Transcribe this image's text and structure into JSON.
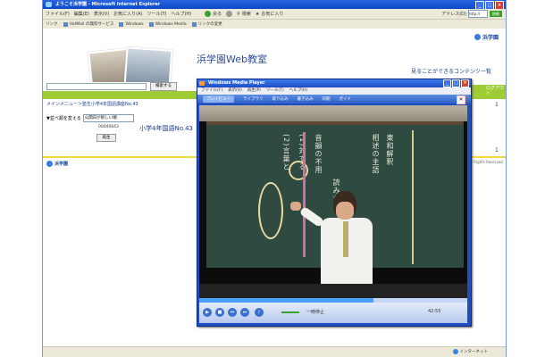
{
  "browser": {
    "title": "ようこそ浜学園 - Microsoft Internet Explorer",
    "menu": [
      "ファイル(F)",
      "編集(E)",
      "表示(V)",
      "お気に入り(A)",
      "ツール(T)",
      "ヘルプ(H)"
    ],
    "back_label": "戻る",
    "search_label": "検索",
    "favorites_label": "お気に入り",
    "address_label": "アドレス(D)",
    "address_value": "http://",
    "go_label": "移動",
    "links": [
      "リンク",
      "HotMail の無料サービス",
      "Windows",
      "Windows Media",
      "リンクの変更"
    ],
    "status_zone": "インターネット"
  },
  "page": {
    "logo": "浜学園",
    "site_title": "浜学園Web教室",
    "site_link": "見ることができるコンテンツ一覧",
    "search_button": "検索する",
    "breadcrumb": "メインメニュー＞塾生小学4年国語講座No.43",
    "order_label": "▼並べ順を変える",
    "order_value": "公開日が新しい順",
    "count": "00040643",
    "course_link": "小学4年国語No.43",
    "play_button": "再生",
    "right_nav": "ログアウト",
    "page_num_top": "1",
    "page_num_bottom": "1",
    "footer_logo": "浜学園",
    "copyright": "All Rights Reserved."
  },
  "wmp": {
    "title": "Windows Media Player",
    "menu": [
      "ファイル(F)",
      "表示(V)",
      "再生(P)",
      "ツール(T)",
      "ヘルプ(H)"
    ],
    "tabs": [
      "プレイビュー",
      "ライブラリ",
      "取り込み",
      "書き込み",
      "同期",
      "ガイド"
    ],
    "status": "一時停止",
    "time": "42:55",
    "seek_progress": 0.65,
    "board_text": [
      "東和解釈",
      "相述の主語",
      "音韻の不用",
      "(1)対する",
      "(2)言葉と",
      "読みかた"
    ]
  }
}
